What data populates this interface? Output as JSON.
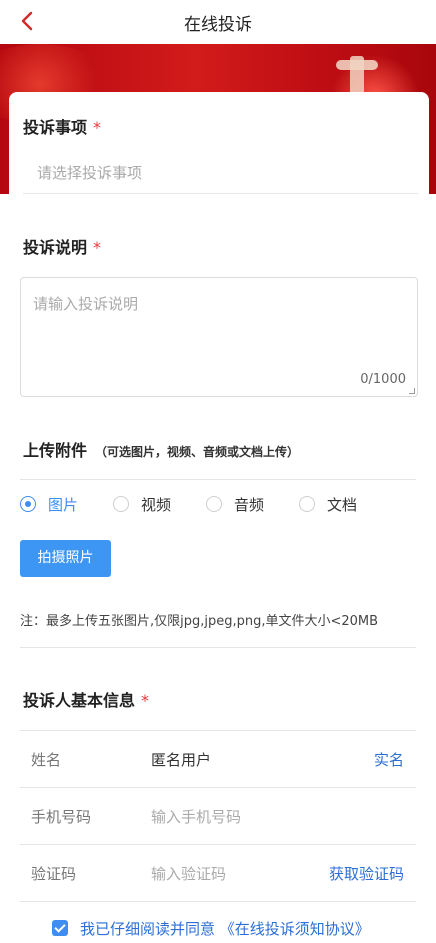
{
  "nav": {
    "title": "在线投诉"
  },
  "complaint_item": {
    "title": "投诉事项",
    "required_mark": "*",
    "placeholder": "请选择投诉事项"
  },
  "complaint_desc": {
    "title": "投诉说明",
    "required_mark": "*",
    "placeholder": "请输入投诉说明",
    "counter": "0/1000"
  },
  "attachments": {
    "title": "上传附件",
    "hint": "（可选图片，视频、音频或文档上传）",
    "options": [
      {
        "label": "图片",
        "checked": true
      },
      {
        "label": "视频",
        "checked": false
      },
      {
        "label": "音频",
        "checked": false
      },
      {
        "label": "文档",
        "checked": false
      }
    ],
    "photo_button": "拍摄照片",
    "note": "注：最多上传五张图片,仅限jpg,jpeg,png,单文件大小<20MB"
  },
  "complainant": {
    "title": "投诉人基本信息",
    "required_mark": "*",
    "name_label": "姓名",
    "name_value": "匿名用户",
    "name_action": "实名",
    "phone_label": "手机号码",
    "phone_placeholder": "输入手机号码",
    "code_label": "验证码",
    "code_placeholder": "输入验证码",
    "code_action": "获取验证码"
  },
  "agreement": {
    "text": "我已仔细阅读并同意 《在线投诉须知协议》",
    "checked": true
  },
  "colors": {
    "accent": "#3f8cf3",
    "required": "#e4393c",
    "link": "#2b6fd6",
    "banner": "#c8121a"
  }
}
